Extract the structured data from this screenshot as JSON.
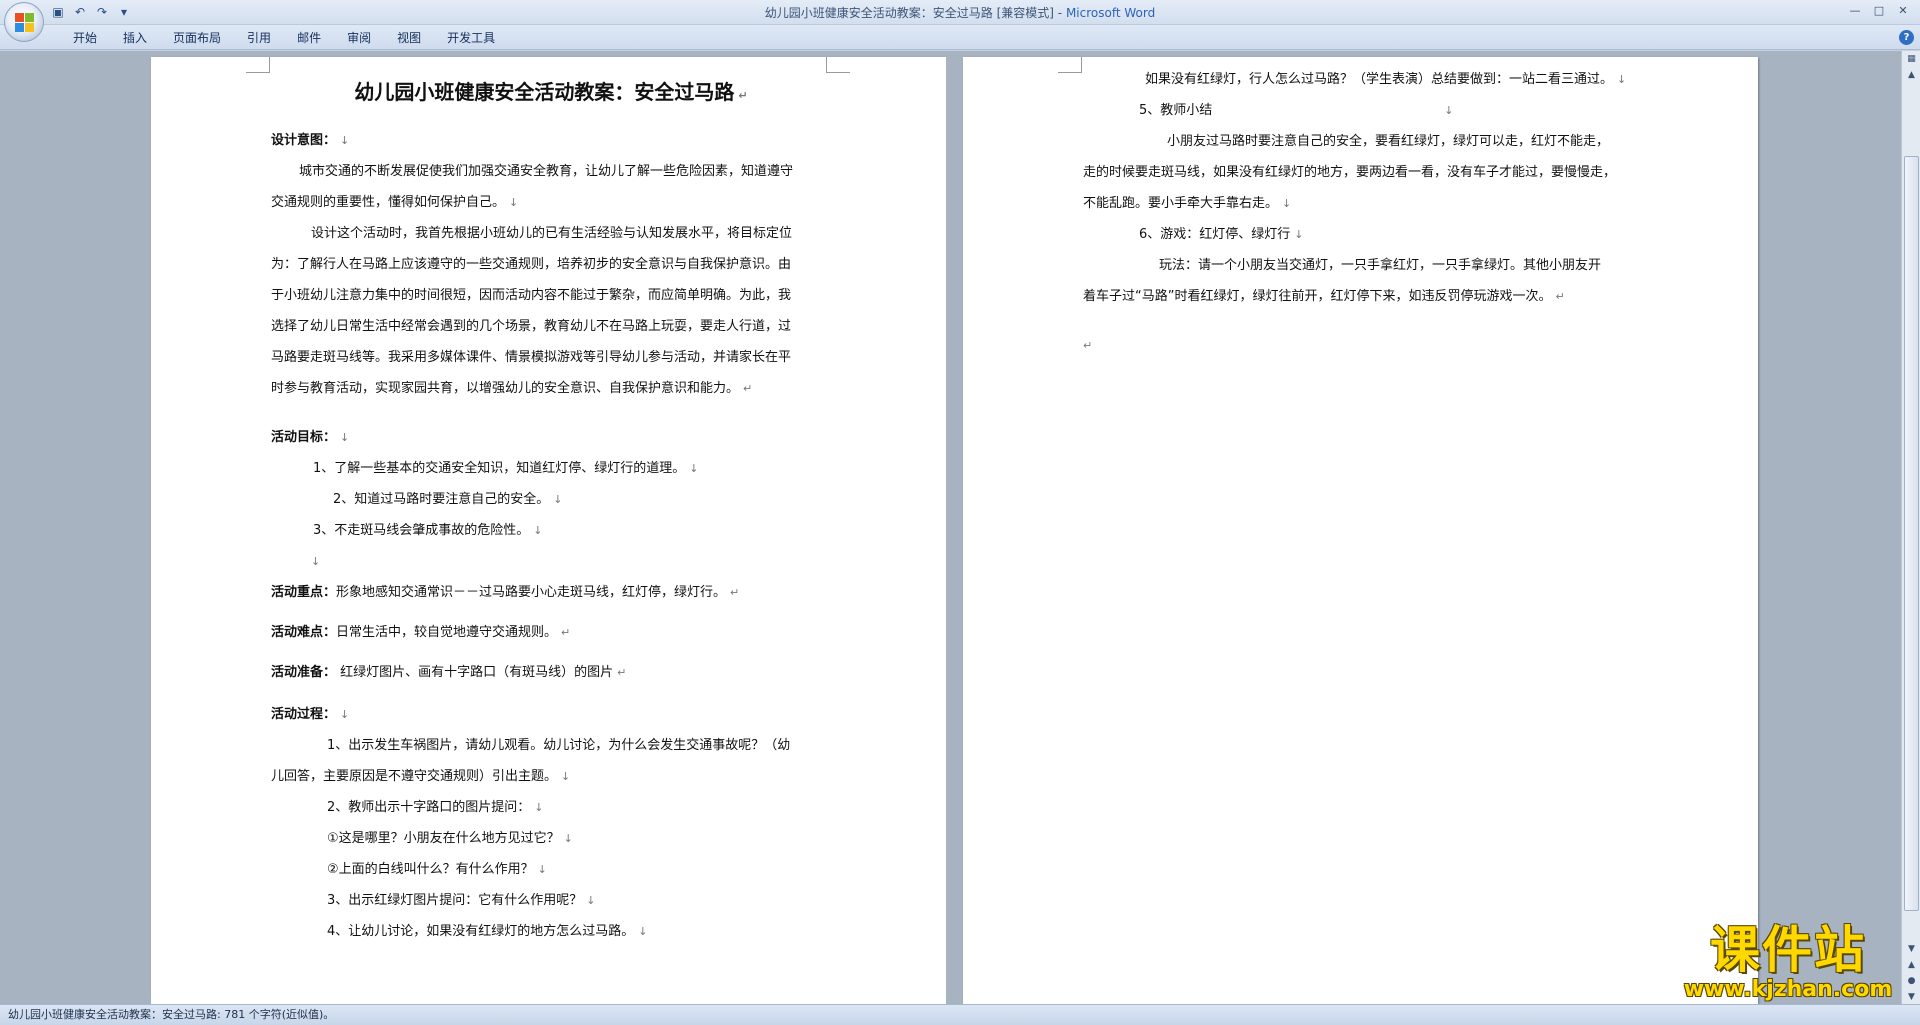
{
  "window": {
    "title": "幼儿园小班健康安全活动教案：安全过马路 [兼容模式]",
    "separator": " - ",
    "app_name": "Microsoft Word"
  },
  "ribbon": {
    "tabs": [
      "开始",
      "插入",
      "页面布局",
      "引用",
      "邮件",
      "审阅",
      "视图",
      "开发工具"
    ]
  },
  "icons": {
    "office": "office-logo-icon",
    "save": "save-icon",
    "undo": "undo-icon",
    "redo": "redo-icon",
    "customize": "chevron-down-icon",
    "help": "help-icon"
  },
  "page1": {
    "title": "幼儿园小班健康安全活动教案：安全过马路",
    "design_head": "设计意图：",
    "design_p1a": "城市交通的不断发展促使我们加强交通安全教育，让幼儿了解一些危险因素，知道遵守",
    "design_p1b": "交通规则的重要性，懂得如何保护自己。",
    "design_p2a": "设计这个活动时，我首先根据小班幼儿的已有生活经验与认知发展水平，将目标定位",
    "design_p2b": "为：了解行人在马路上应该遵守的一些交通规则，培养初步的安全意识与自我保护意识。由",
    "design_p2c": "于小班幼儿注意力集中的时间很短，因而活动内容不能过于繁杂，而应简单明确。为此，我",
    "design_p2d": "选择了幼儿日常生活中经常会遇到的几个场景，教育幼儿不在马路上玩耍，要走人行道，过",
    "design_p2e": "马路要走斑马线等。我采用多媒体课件、情景模拟游戏等引导幼儿参与活动，并请家长在平",
    "design_p2f": "时参与教育活动，实现家园共育，以增强幼儿的安全意识、自我保护意识和能力。",
    "goal_head": "活动目标：",
    "goal_1": "1、了解一些基本的交通安全知识，知道红灯停、绿灯行的道理。",
    "goal_2": "2、知道过马路时要注意自己的安全。",
    "goal_3": "3、不走斑马线会肇成事故的危险性。",
    "key_head": "活动重点：",
    "key_text": "形象地感知交通常识－－过马路要小心走斑马线，红灯停，绿灯行。",
    "diff_head": "活动难点：",
    "diff_text": "日常生活中，较自觉地遵守交通规则。",
    "prep_head": "活动准备：",
    "prep_text": " 红绿灯图片、画有十字路口（有斑马线）的图片",
    "proc_head": "活动过程：",
    "proc_1a": "1、出示发生车祸图片，请幼儿观看。幼儿讨论，为什么会发生交通事故呢？（幼",
    "proc_1b": "儿回答，主要原因是不遵守交通规则）引出主题。",
    "proc_2": "2、教师出示十字路口的图片提问：",
    "proc_2q1": "①这是哪里？小朋友在什么地方见过它？",
    "proc_2q2": "②上面的白线叫什么？有什么作用？",
    "proc_3": "3、出示红绿灯图片提问：它有什么作用呢？",
    "proc_4": "4、让幼儿讨论，如果没有红绿灯的地方怎么过马路。"
  },
  "page2": {
    "l1": "如果没有红绿灯，行人怎么过马路？（学生表演）总结要做到：一站二看三通过。",
    "s5": "5、教师小结",
    "s5a": "小朋友过马路时要注意自己的安全，要看红绿灯，绿灯可以走，红灯不能走，",
    "s5b": "走的时候要走斑马线，如果没有红绿灯的地方，要两边看一看，没有车子才能过，要慢慢走，",
    "s5c": "不能乱跑。要小手牵大手靠右走。",
    "s6": "6、游戏：红灯停、绿灯行",
    "s6a": "玩法：请一个小朋友当交通灯，一只手拿红灯，一只手拿绿灯。其他小朋友开",
    "s6b": "着车子过“马路”时看红绿灯，绿灯往前开，红灯停下来，如违反罚停玩游戏一次。"
  },
  "marks": {
    "line_break": "↓",
    "paragraph": "↵"
  },
  "statusbar": {
    "text": "幼儿园小班健康安全活动教案：安全过马路: 781 个字符(近似值)。"
  },
  "watermark": {
    "name": "课件站",
    "url": "www.kjzhan.com"
  },
  "colors": {
    "title_app": "#2d63b8",
    "watermark": "#ffd800"
  }
}
